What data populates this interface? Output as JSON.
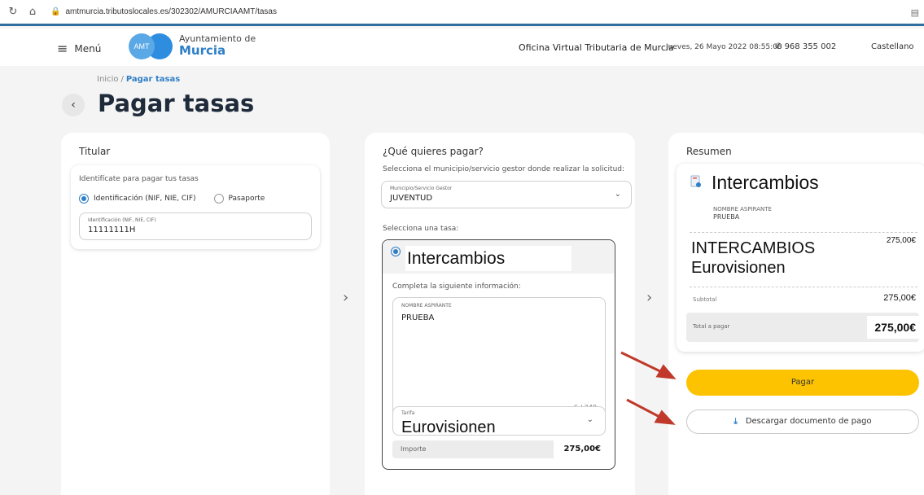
{
  "browser": {
    "url": "amtmurcia.tributoslocales.es/302302/AMURCIAAMT/tasas"
  },
  "header": {
    "menu_label": "Menú",
    "logo_text": "AMT",
    "org_line1": "Ayuntamiento de",
    "org_line2": "Murcia",
    "office": "Oficina Virtual Tributaria de Murcia",
    "date": "Jueves, 26 Mayo 2022 08:55:08",
    "phone": "968 355 002",
    "language": "Castellano"
  },
  "breadcrumb": {
    "home": "Inicio",
    "separator": "/",
    "current": "Pagar tasas"
  },
  "page_title": "Pagar tasas",
  "titular": {
    "heading": "Titular",
    "hint": "Identifícate para pagar tus tasas",
    "option_id": "Identificación (NIF, NIE, CIF)",
    "option_passport": "Pasaporte",
    "field_label": "Identificación (NIF, NIE, CIF)",
    "field_value": "11111111H"
  },
  "que_pagar": {
    "heading": "¿Qué quieres pagar?",
    "subtitle": "Selecciona el municipio/servicio gestor donde realizar la solicitud:",
    "municipio_label": "Municipio/Servicio Gestor",
    "municipio_value": "JUVENTUD",
    "tasa_prompt": "Selecciona una tasa:",
    "tasa_name": "Intercambios",
    "complete_hint": "Completa la siguiente información:",
    "nombre_label": "NOMBRE ASPIRANTE",
    "nombre_value": "PRUEBA",
    "counter": "6 / 240",
    "tarifa_label": "Tarifa",
    "tarifa_value": "Eurovisionen",
    "importe_label": "Importe",
    "importe_value": "275,00€"
  },
  "resumen": {
    "heading": "Resumen",
    "item_name": "Intercambios",
    "aspirante_label": "NOMBRE ASPIRANTE",
    "aspirante_value": "PRUEBA",
    "desc_line1": "INTERCAMBIOS",
    "desc_line2": "Eurovisionen",
    "desc_amount": "275,00€",
    "subtotal_label": "Subtotal",
    "subtotal_value": "275,00€",
    "total_label": "Total a pagar",
    "total_value": "275,00€",
    "pay_button": "Pagar",
    "download_button": "Descargar documento de pago"
  },
  "colors": {
    "accent_blue": "#2f7fc7",
    "pay_yellow": "#fdc300",
    "annotation_red": "#c0392b"
  }
}
